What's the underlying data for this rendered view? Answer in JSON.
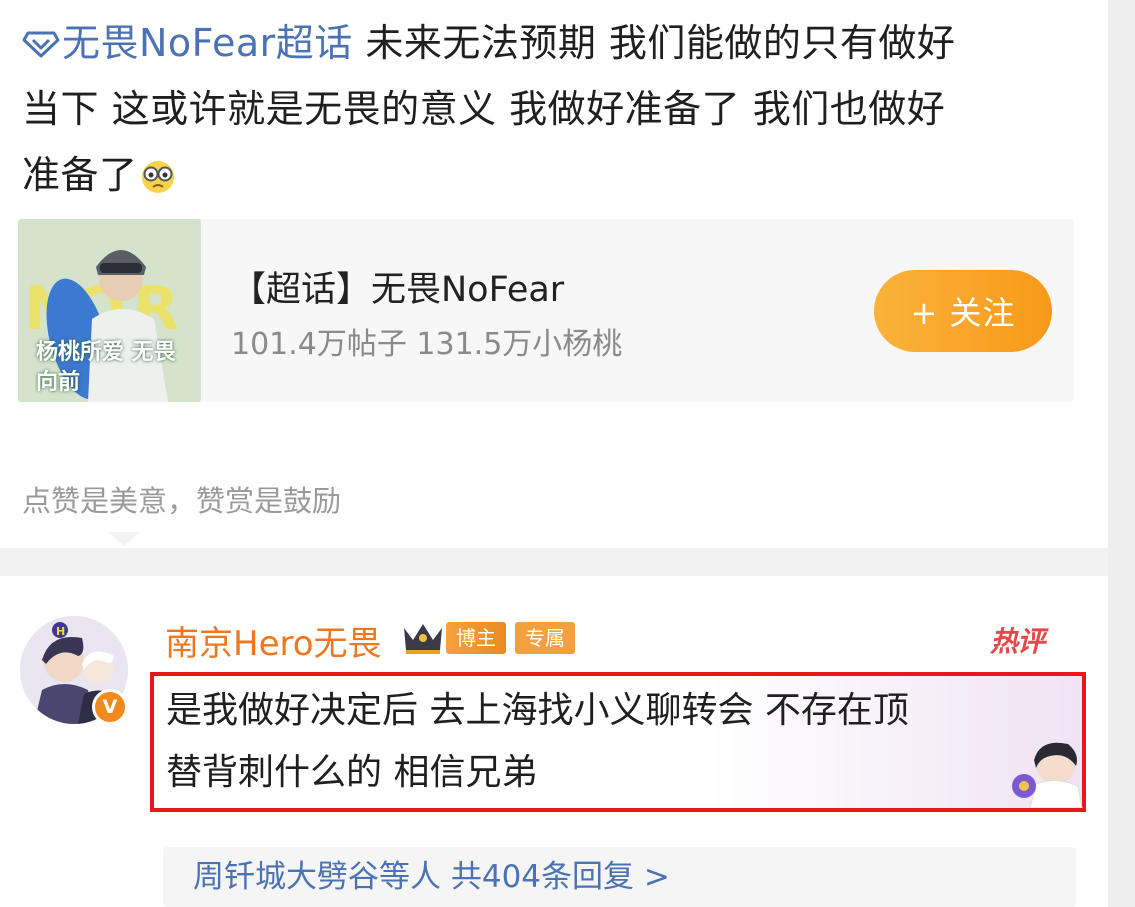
{
  "post": {
    "topic_link": "无畏NoFear超话",
    "text_line1": "  未来无法预期  我们能做的只有做好",
    "text_line2": "当下  这或许就是无畏的意义 我做好准备了 我们也做好",
    "text_line3": "准备了",
    "topic_card": {
      "title": "【超话】无畏NoFear",
      "stats": "101.4万帖子 131.5万小杨桃",
      "follow_label": "+ 关注",
      "thumb_text": "杨桃所爱 无畏向前"
    },
    "reward_text": "点赞是美意，赞赏是鼓励"
  },
  "comment": {
    "username": "南京Hero无畏",
    "badge_blogger": "博主",
    "badge_exclusive": "专属",
    "hot_label": "热评",
    "verified_mark": "V",
    "text_line1": "是我做好决定后 去上海找小义聊转会 不存在顶",
    "text_line2": "替背刺什么的 相信兄弟",
    "replies": "周钎城大劈谷等人  共404条回复  >"
  },
  "colors": {
    "link_blue": "#4b73b4",
    "username_orange": "#f0771e",
    "follow_orange": "#f79a19",
    "highlight_red": "#e8171b",
    "hot_red": "#e24a4a"
  }
}
